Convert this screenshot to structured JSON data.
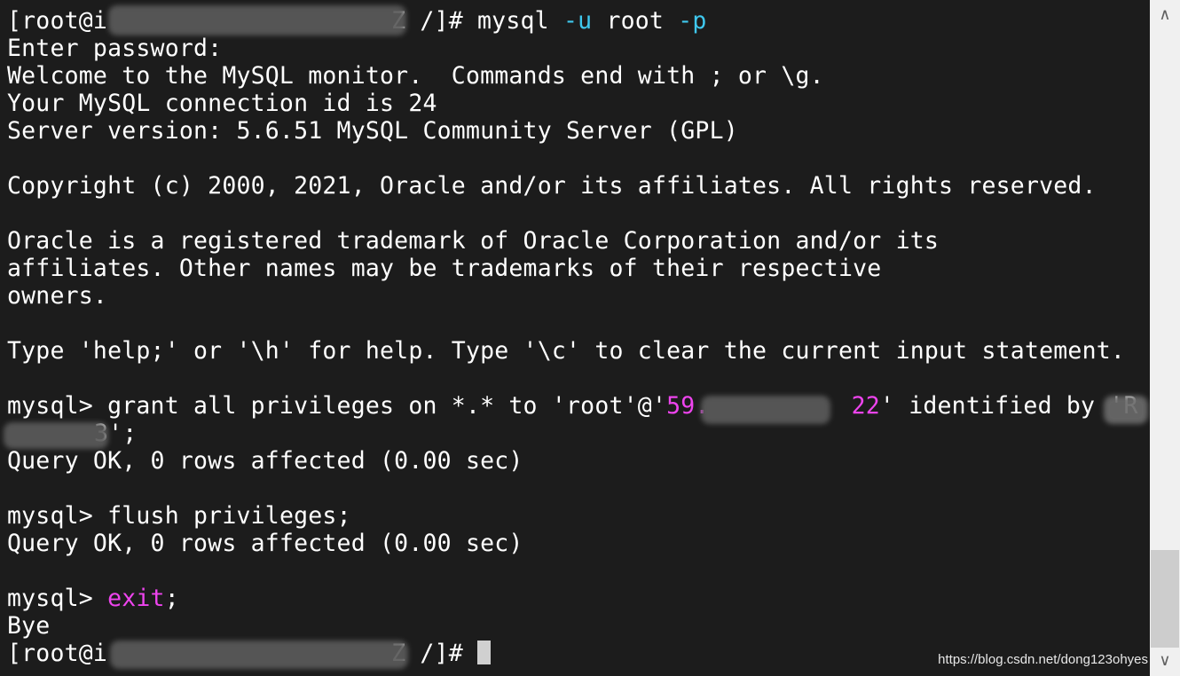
{
  "terminal": {
    "prompt_start": "[root@i",
    "prompt_end": "Z /]# ",
    "first_cmd": "mysql",
    "flag_u": "-u",
    "user": "root",
    "flag_p": "-p",
    "output": [
      "Enter password:",
      "Welcome to the MySQL monitor.  Commands end with ; or \\g.",
      "Your MySQL connection id is 24",
      "Server version: 5.6.51 MySQL Community Server (GPL)",
      "",
      "Copyright (c) 2000, 2021, Oracle and/or its affiliates. All rights reserved.",
      "",
      "Oracle is a registered trademark of Oracle Corporation and/or its",
      "affiliates. Other names may be trademarks of their respective",
      "owners.",
      "",
      "Type 'help;' or '\\h' for help. Type '\\c' to clear the current input statement.",
      ""
    ],
    "grant_line": {
      "prefix": "mysql> grant all privileges on *.* to 'root'@'",
      "ip_start": "59.",
      "ip_end": "2",
      "ip_end_tail": "2",
      "middle": "' identified by 'R",
      "wrap_tail": "3';"
    },
    "grant_result": "Query OK, 0 rows affected (0.00 sec)",
    "flush_prompt": "mysql> ",
    "flush_cmd": "flush privileges;",
    "flush_result": "Query OK, 0 rows affected (0.00 sec)",
    "exit_prompt": "mysql> ",
    "exit_cmd": "exit",
    "exit_semicolon": ";",
    "bye": "Bye",
    "final_prompt_start": "[root@i",
    "final_prompt_end": "Z /]# "
  },
  "scrollbar": {
    "up_icon": "∧",
    "down_icon": "∨"
  },
  "watermark": "https://blog.csdn.net/dong123ohyes",
  "colors": {
    "background": "#1c1c1c",
    "text": "#ffffff",
    "option": "#3fc8ee",
    "keyword": "#ee44ee"
  }
}
